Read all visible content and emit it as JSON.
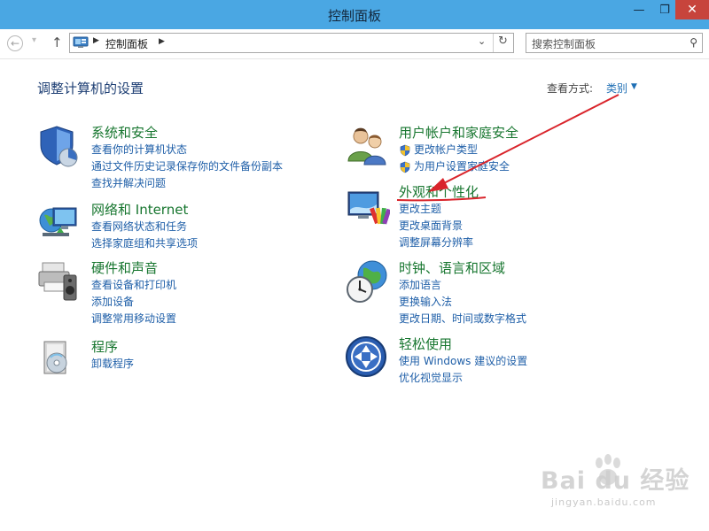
{
  "window": {
    "title": "控制面板",
    "minimize_glyph": "—",
    "maximize_glyph": "❐",
    "close_glyph": "✕"
  },
  "nav": {
    "back_glyph": "←",
    "forward_glyph": "▾",
    "up_glyph": "↑",
    "breadcrumb": "控制面板",
    "crumb_sep": "▶",
    "dropdown_glyph": "⌄",
    "refresh_glyph": "↻",
    "search_placeholder": "搜索控制面板",
    "search_glyph": "⚲"
  },
  "main": {
    "heading": "调整计算机的设置",
    "view_by_label": "查看方式:",
    "view_by_value": "类别",
    "view_by_caret": "▼"
  },
  "categories": [
    {
      "title": "系统和安全",
      "icon": "system-security-icon",
      "links": [
        "查看你的计算机状态",
        "通过文件历史记录保存你的文件备份副本",
        "查找并解决问题"
      ]
    },
    {
      "title": "网络和 Internet",
      "icon": "network-icon",
      "links": [
        "查看网络状态和任务",
        "选择家庭组和共享选项"
      ]
    },
    {
      "title": "硬件和声音",
      "icon": "hardware-sound-icon",
      "links": [
        "查看设备和打印机",
        "添加设备",
        "调整常用移动设置"
      ]
    },
    {
      "title": "程序",
      "icon": "programs-icon",
      "links": [
        "卸载程序"
      ]
    },
    {
      "title": "用户帐户和家庭安全",
      "icon": "user-accounts-icon",
      "links": [
        "更改帐户类型",
        "为用户设置家庭安全"
      ],
      "shield_links": true
    },
    {
      "title": "外观和个性化",
      "icon": "appearance-icon",
      "links": [
        "更改主题",
        "更改桌面背景",
        "调整屏幕分辨率"
      ]
    },
    {
      "title": "时钟、语言和区域",
      "icon": "clock-region-icon",
      "links": [
        "添加语言",
        "更换输入法",
        "更改日期、时间或数字格式"
      ]
    },
    {
      "title": "轻松使用",
      "icon": "ease-of-access-icon",
      "links": [
        "使用 Windows 建议的设置",
        "优化视觉显示"
      ]
    }
  ],
  "colors": {
    "titlebar": "#4aa7e3",
    "close": "#c7443c",
    "category_title": "#17762f",
    "link": "#1f5fa8",
    "annotation": "#d9242b"
  },
  "watermark": {
    "line1": "Bai du 经验",
    "line2": "jingyan.baidu.com"
  }
}
